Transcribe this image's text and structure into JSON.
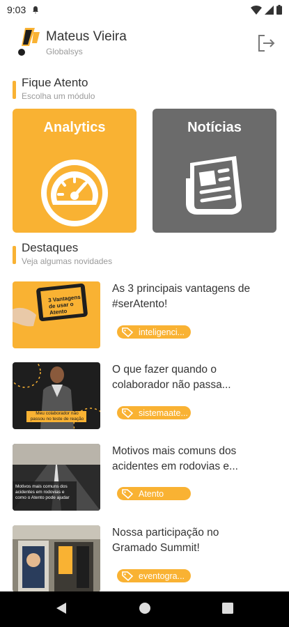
{
  "status_bar": {
    "time": "9:03"
  },
  "header": {
    "user_name": "Mateus Vieira",
    "company": "Globalsys"
  },
  "section_attention": {
    "title": "Fique Atento",
    "subtitle": "Escolha um módulo"
  },
  "modules": [
    {
      "label": "Analytics",
      "color": "#F9B233",
      "icon": "speedometer-icon"
    },
    {
      "label": "Notícias",
      "color": "#6b6b6b",
      "icon": "newspaper-icon"
    }
  ],
  "section_highlights": {
    "title": "Destaques",
    "subtitle": "Veja algumas novidades"
  },
  "news": [
    {
      "title": "As 3 principais vantagens de #serAtento!",
      "tag": "inteligenci...",
      "thumb_text": "3 Vantagens de usar o Atento"
    },
    {
      "title": "O que fazer quando o colaborador não passa...",
      "tag": "sistemaate...",
      "thumb_text": "Meu colaborador não passou no teste de reação"
    },
    {
      "title": "Motivos mais comuns dos acidentes em rodovias e...",
      "tag": "Atento",
      "thumb_text": "Motivos mais comuns dos acidentes em rodovias e como o Atento pode ajudar"
    },
    {
      "title": "Nossa participação no Gramado Summit!",
      "tag": "eventogra...",
      "thumb_text": ""
    }
  ],
  "colors": {
    "accent": "#F9B233",
    "muted_card": "#6b6b6b",
    "navbar": "#000000"
  }
}
